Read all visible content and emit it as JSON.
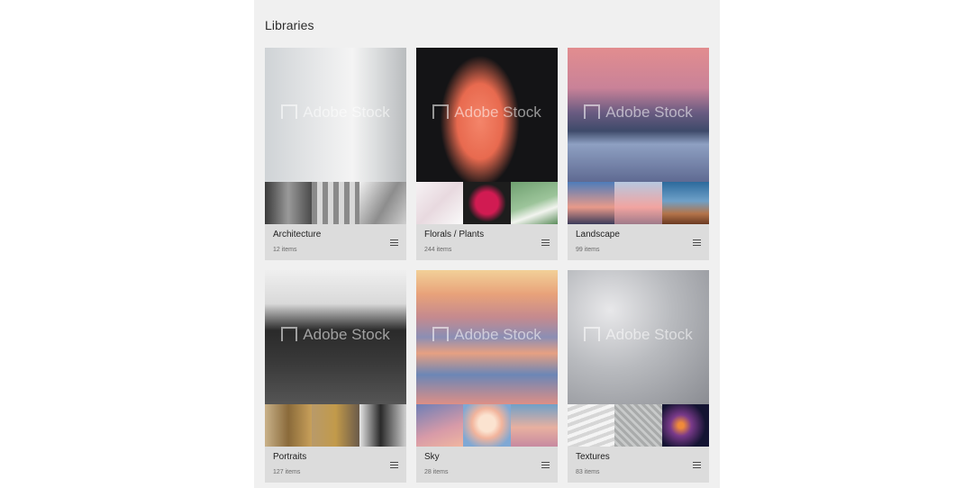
{
  "page": {
    "title": "Libraries"
  },
  "watermark": "Adobe Stock",
  "icons": {
    "menu": "hamburger-menu-icon",
    "watermark": "adobe-logo-icon"
  },
  "libraries": [
    {
      "name": "Architecture",
      "count": "12 items",
      "hero": "linear-gradient(90deg,#cfd3d6 0%,#e8e9ea 40%,#f4f4f4 62%,#dcdedf 78%,#b9bcbe 100%)",
      "thumbs": [
        "linear-gradient(90deg,#3a3a3a,#9a9a9a 50%,#4a4a4a)",
        "repeating-linear-gradient(90deg,#8a8a8a 0 6px,#d8d8d8 6px 12px)",
        "linear-gradient(120deg,#f0f0f0,#8d8d8d 55%,#cfcfcf)"
      ]
    },
    {
      "name": "Florals / Plants",
      "count": "244 items",
      "hero": "radial-gradient(ellipse 40% 70% at 45% 55%, #f4856a 0%, #e86a4f 40%, rgba(20,20,22,0) 70%), #141416",
      "thumbs": [
        "linear-gradient(135deg,#f6f2f4,#e8d9df 50%,#fafafa)",
        "radial-gradient(circle at 50% 50%,#d11b52 0 35%,#1d1d1d 60%)",
        "linear-gradient(160deg,#6fa070,#9cc49a 50%,#f2f4ef 70%,#5a8c5a)"
      ]
    },
    {
      "name": "Landscape",
      "count": "99 items",
      "hero": "linear-gradient(180deg,#e28d8f 0%,#c98298 30%,#6b5c82 48%,#3e4a6a 62%,#8ea0c2 72%,#5f6a92 100%)",
      "thumbs": [
        "linear-gradient(180deg,#4e7cba,#e89a8a 60%,#3c3c5a)",
        "linear-gradient(180deg,#b7c8e0,#f2a4a0 60%,#a07a8a)",
        "linear-gradient(180deg,#2c6a9c,#6ea0c8 45%,#b4744a 75%,#6a3a22)"
      ]
    },
    {
      "name": "Portraits",
      "count": "127 items",
      "hero": "linear-gradient(180deg,#efefef 0%,#d9d9d9 25%,#2a2a2a 45%,#3a3a3a 70%,#555555 100%)",
      "thumbs": [
        "linear-gradient(90deg,#c9b28a,#8a6a3a 50%,#c8a05a)",
        "linear-gradient(90deg,#b89a6a,#c29a4a 50%,#6a5a4a)",
        "linear-gradient(90deg,#e6e6e6,#2a2a2a 45%,#d0d0d0)"
      ]
    },
    {
      "name": "Sky",
      "count": "28 items",
      "hero": "linear-gradient(180deg,#f2d098 0%,#e8a27a 18%,#c58a8e 35%,#8b8eb4 50%,#e6a082 62%,#6c86b6 78%,#dd8f86 100%)",
      "thumbs": [
        "linear-gradient(160deg,#6f7fb6,#d79aa8 60%,#f0b6a0)",
        "radial-gradient(circle at 50% 45%,#fbe3d0 0 25%,#f2b49c 45%,#7fa8d4 80%)",
        "linear-gradient(180deg,#6fa0c8,#e8b0a0 55%,#c78aa0)"
      ]
    },
    {
      "name": "Textures",
      "count": "83 items",
      "hero": "radial-gradient(ellipse at 30% 30%,#e8e8ea 0%,#b8babe 45%,#8a8c92 100%)",
      "thumbs": [
        "repeating-linear-gradient(160deg,#f4f4f4 0 4px,#d6d6d6 4px 8px)",
        "repeating-linear-gradient(45deg,#a9abab 0 3px,#c8caca 3px 6px)",
        "radial-gradient(circle at 40% 50%,#f08a3a 0 8%,#7a3a8a 30%,#141432 70%)"
      ]
    }
  ]
}
